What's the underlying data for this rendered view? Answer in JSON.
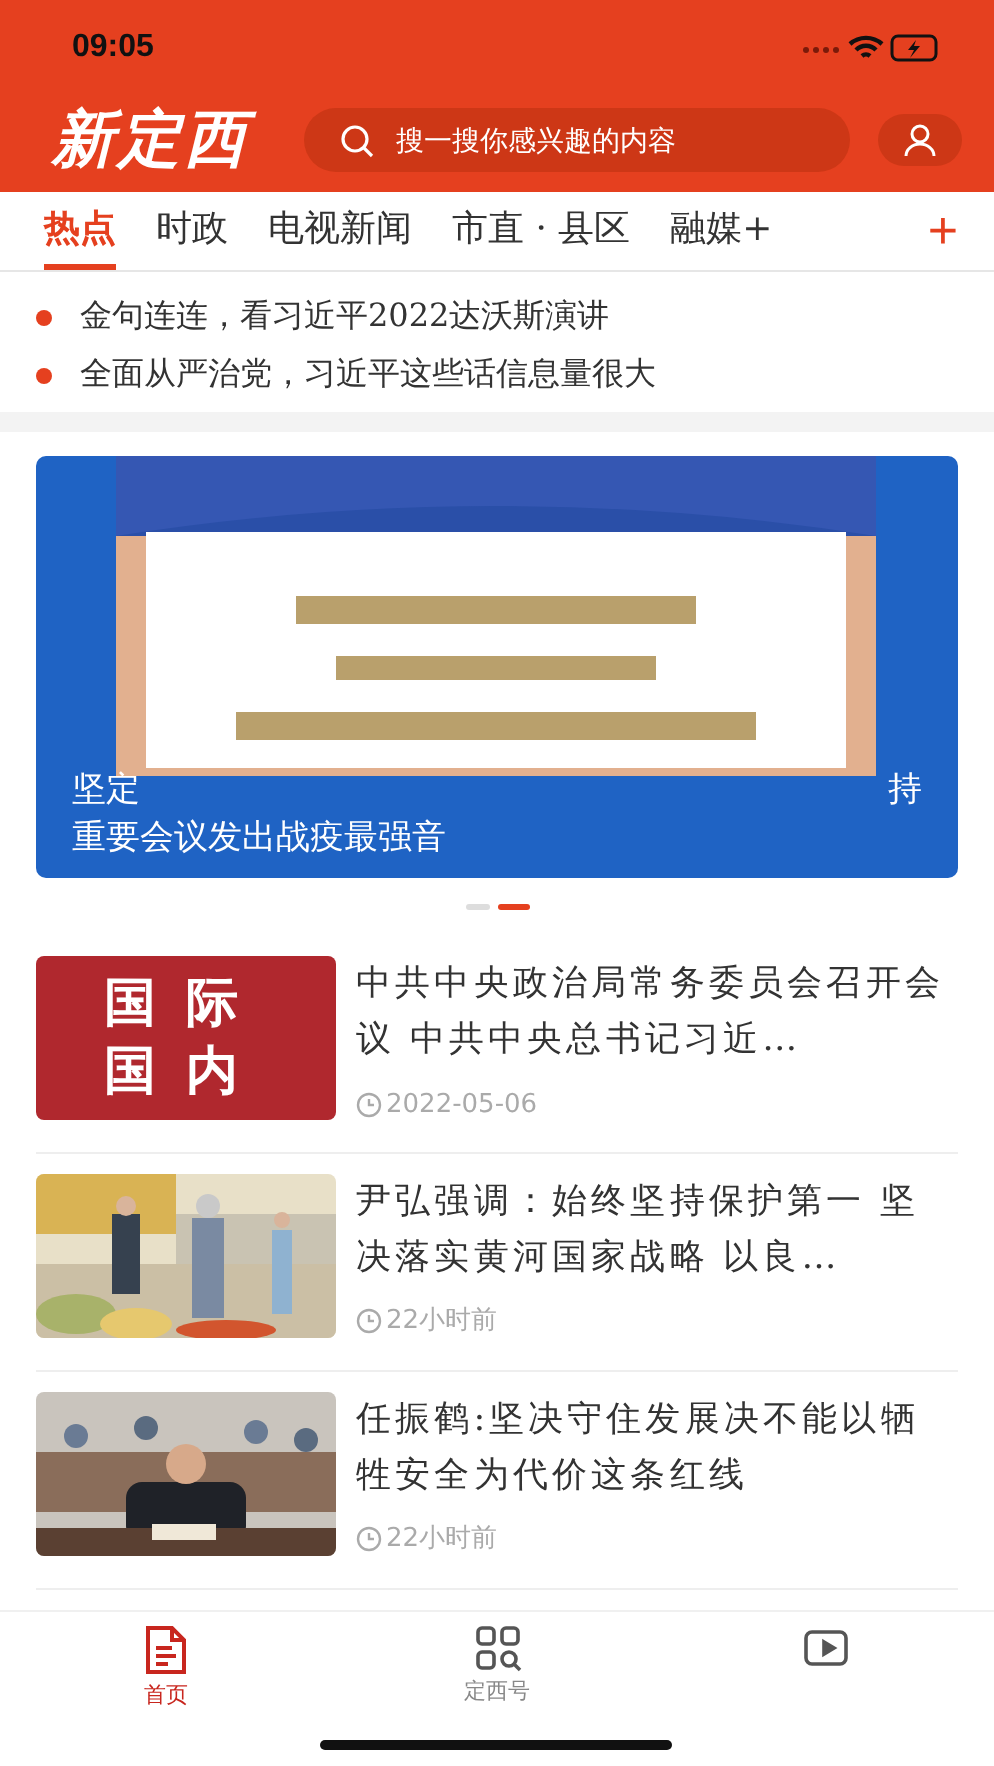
{
  "status_bar": {
    "time": "09:05"
  },
  "header": {
    "logo": "新定西",
    "search": {
      "placeholder": "搜一搜你感兴趣的内容"
    }
  },
  "channels": [
    {
      "label": "热点",
      "selected": true
    },
    {
      "label": "时政",
      "selected": false
    },
    {
      "label": "电视新闻",
      "selected": false
    },
    {
      "label": "市直 · 县区",
      "selected": false
    },
    {
      "label": "融媒+",
      "selected": false
    }
  ],
  "add_channel": "+",
  "headlines": [
    "金句连连，看习近平2022达沃斯演讲",
    "全面从严治党，习近平这些话信息量很大"
  ],
  "banner": {
    "kind": "picture",
    "caption_parts": [
      "坚定",
      "持"
    ],
    "caption_line2": "重要会议发出战疫最强音",
    "slides": [
      {
        "selected": false
      },
      {
        "selected": true
      }
    ]
  },
  "news": [
    {
      "kind": "label",
      "thumb_text": [
        "国 际",
        "国 内"
      ],
      "title": "中共中央政治局常务委员会召开会议  中共中央总书记习近…",
      "time": "2022-05-06"
    },
    {
      "kind": "picture",
      "title": "尹弘强调：始终坚持保护第一  坚决落实黄河国家战略  以良…",
      "time": "22小时前"
    },
    {
      "kind": "picture",
      "title": "任振鹤:坚决守住发展决不能以牺牲安全为代价这条红线",
      "time": "22小时前"
    }
  ],
  "tab_bar": [
    {
      "label": "首页",
      "selected": true
    },
    {
      "label": "定西号",
      "selected": false
    },
    {
      "selected": false
    }
  ]
}
